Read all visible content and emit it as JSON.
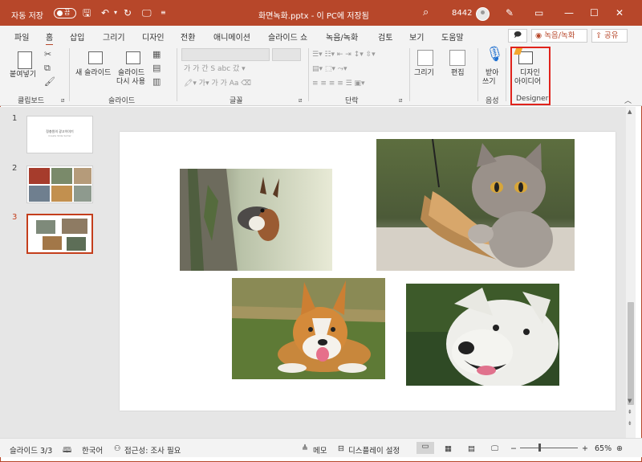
{
  "titlebar": {
    "autosave": "자동 저장",
    "autosave_state": "끔",
    "doc_title": "화면녹화.pptx - 이 PC에 저장됨",
    "user_count": "8442",
    "bg_color": "#b7472a"
  },
  "tabs": [
    "파일",
    "홈",
    "삽입",
    "그리기",
    "디자인",
    "전환",
    "애니메이션",
    "슬라이드 쇼",
    "녹음/녹화",
    "검토",
    "보기",
    "도움말"
  ],
  "active_tab": "홈",
  "header_buttons": {
    "record": "◉ 녹음/녹화",
    "share": "공유"
  },
  "ribbon": {
    "paste_label": "붙여넣기",
    "new_slide_label": "새 슬라이드",
    "reuse_label_1": "슬라이드",
    "reuse_label_2": "다시 사용",
    "draw_label": "그리기",
    "edit_label": "편집",
    "dictate_label_1": "받아",
    "dictate_label_2": "쓰기",
    "designer_label_1": "디자인",
    "designer_label_2": "아이디어",
    "groups": {
      "clipboard": "클립보드",
      "slides": "슬라이드",
      "font": "글꼴",
      "paragraph": "단락",
      "voice": "음성",
      "designer": "Designer"
    }
  },
  "thumbnails": [
    {
      "num": "1",
      "title": "정충원의 광고이야기",
      "subtitle": "Create Slide Sorter"
    },
    {
      "num": "2"
    },
    {
      "num": "3"
    }
  ],
  "statusbar": {
    "slide_info": "슬라이드 3/3",
    "language": "한국어",
    "accessibility": "접근성: 조사 필요",
    "notes": "메모",
    "display_settings": "디스플레이 설정",
    "zoom": "65%"
  }
}
